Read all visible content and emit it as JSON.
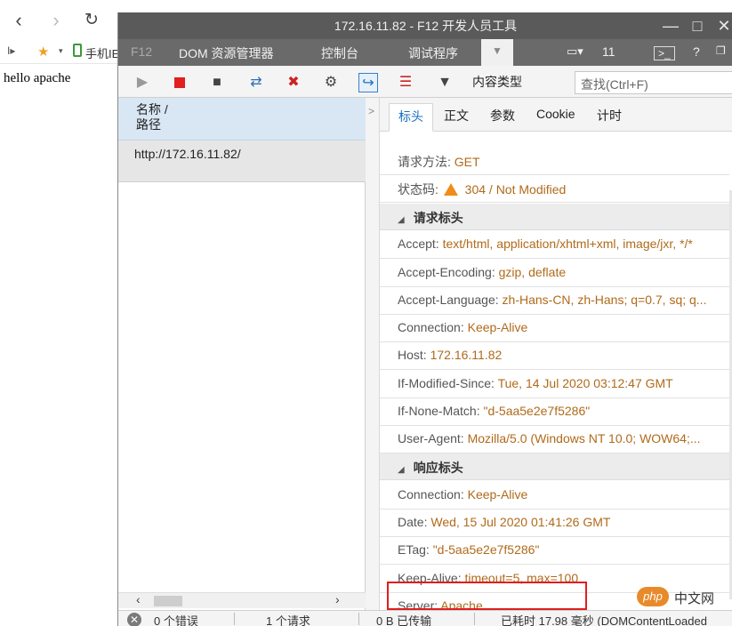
{
  "browser": {
    "back_icon": "back-arrow-icon",
    "forward_icon": "forward-arrow-icon",
    "reload_icon": "reload-icon",
    "favorites_label": "手机IE",
    "page_text": "hello apache"
  },
  "devtools": {
    "title": "172.16.11.82 - F12 开发人员工具",
    "tabs": [
      "F12",
      "DOM 资源管理器",
      "控制台",
      "调试程序"
    ],
    "emulation_count": "11",
    "toolbar": {
      "content_type_label": "内容类型",
      "find_placeholder": "查找(Ctrl+F)"
    },
    "request_list": {
      "header_line1": "名称 /",
      "header_line2": "路径",
      "rows": [
        "http://172.16.11.82/"
      ]
    },
    "detail_tabs": [
      "标头",
      "正文",
      "参数",
      "Cookie",
      "计时"
    ],
    "summary": {
      "method_key": "请求方法:",
      "method_val": "GET",
      "status_key": "状态码:",
      "status_val": "304 / Not Modified"
    },
    "request_headers_title": "请求标头",
    "request_headers": [
      {
        "key": "Accept:",
        "val": "text/html, application/xhtml+xml, image/jxr, */*"
      },
      {
        "key": "Accept-Encoding:",
        "val": "gzip, deflate"
      },
      {
        "key": "Accept-Language:",
        "val": "zh-Hans-CN, zh-Hans; q=0.7, sq; q..."
      },
      {
        "key": "Connection:",
        "val": "Keep-Alive"
      },
      {
        "key": "Host:",
        "val": "172.16.11.82"
      },
      {
        "key": "If-Modified-Since:",
        "val": "Tue, 14 Jul 2020 03:12:47 GMT"
      },
      {
        "key": "If-None-Match:",
        "val": "\"d-5aa5e2e7f5286\""
      },
      {
        "key": "User-Agent:",
        "val": "Mozilla/5.0 (Windows NT 10.0; WOW64;..."
      }
    ],
    "response_headers_title": "响应标头",
    "response_headers": [
      {
        "key": "Connection:",
        "val": "Keep-Alive"
      },
      {
        "key": "Date:",
        "val": "Wed, 15 Jul 2020 01:41:26 GMT"
      },
      {
        "key": "ETag:",
        "val": "\"d-5aa5e2e7f5286\""
      },
      {
        "key": "Keep-Alive:",
        "val": "timeout=5, max=100"
      },
      {
        "key": "Server:",
        "val": "Apache"
      }
    ],
    "status_bar": {
      "errors": "0 个错误",
      "requests": "1 个请求",
      "transferred": "0 B 已传输",
      "timing": "已耗时 17.98 毫秒 (DOMContentLoaded"
    }
  },
  "watermark": {
    "logo": "php",
    "text": "中文网"
  },
  "colors": {
    "value_text": "#b06a1a",
    "highlight_border": "#e01e1e",
    "selected_row": "#d8e7f3",
    "warning": "#f08c1a"
  }
}
